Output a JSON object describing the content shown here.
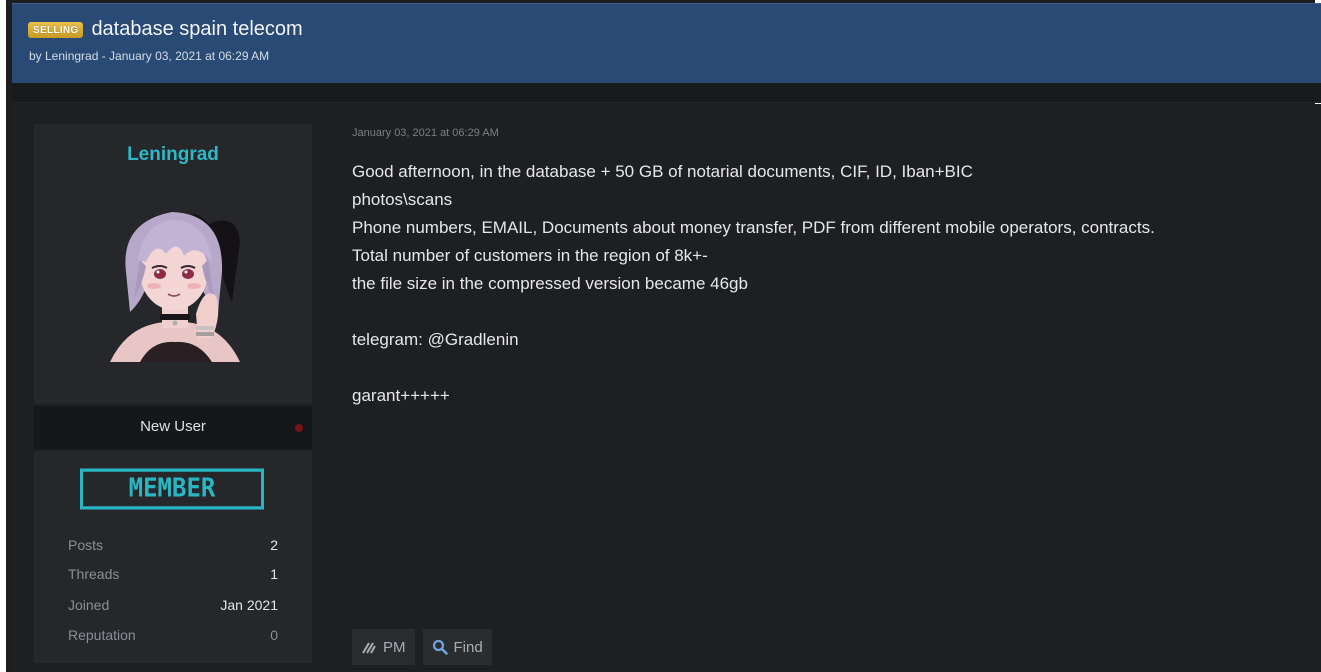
{
  "thread": {
    "prefix": "SELLING",
    "title": "database spain telecom",
    "meta": "by Leningrad - January 03, 2021 at 06:29 AM"
  },
  "author": {
    "username": "Leningrad",
    "avatar_icon": "anime-avatar",
    "rank": "New User",
    "badge": "MEMBER",
    "stats": [
      {
        "label": "Posts",
        "value": "2"
      },
      {
        "label": "Threads",
        "value": "1"
      },
      {
        "label": "Joined",
        "value": "Jan 2021"
      },
      {
        "label": "Reputation",
        "value": "0"
      }
    ]
  },
  "post": {
    "date": "January 03, 2021 at 06:29 AM",
    "lines": [
      "Good afternoon, in the database + 50 GB of notarial documents, CIF, ID, Iban+BIC",
      "photos\\scans",
      "Phone numbers, EMAIL, Documents about money transfer, PDF from different mobile operators, contracts.",
      "Total number of customers in the region of 8k+-",
      "the file size in the compressed version became 46gb",
      "",
      "telegram: @Gradlenin",
      "",
      "garant+++++"
    ]
  },
  "actions": {
    "pm_label": "PM",
    "pm_icon": "signal-icon",
    "find_label": "Find",
    "find_icon": "search-icon"
  },
  "colors": {
    "header_bg": "#284a74",
    "accent_teal": "#2fb8c6",
    "prefix_gold": "#d4a82c",
    "page_bg": "#1e1f21"
  }
}
